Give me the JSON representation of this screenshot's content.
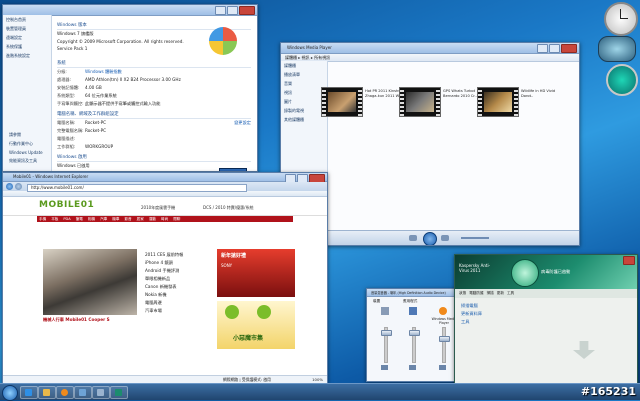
{
  "system_window": {
    "nav": [
      "控制台首頁",
      "裝置管理員",
      "遠端設定",
      "系統保護",
      "進階系統設定"
    ],
    "edition_head": "Windows 版本",
    "edition": "Windows 7 旗艦版",
    "copyright": "Copyright © 2009 Microsoft Corporation. All rights reserved.",
    "sp": "Service Pack 1",
    "system_head": "系統",
    "rows": [
      {
        "k": "分級:",
        "v": "Windows 體驗指數"
      },
      {
        "k": "處理器:",
        "v": "AMD Athlon(tm) II X2 B24 Processor 3.00 GHz"
      },
      {
        "k": "安裝記憶體:",
        "v": "4.00 GB"
      },
      {
        "k": "系統類型:",
        "v": "64 位元作業系統"
      },
      {
        "k": "手寫筆與觸控:",
        "v": "此顯示器不提供手寫筆或觸控式輸入功能"
      }
    ],
    "computer_head": "電腦名稱、網域及工作群組設定",
    "comp_rows": [
      {
        "k": "電腦名稱:",
        "v": "Rocket-PC"
      },
      {
        "k": "完整電腦名稱:",
        "v": "Rocket-PC"
      },
      {
        "k": "電腦描述:",
        "v": ""
      },
      {
        "k": "工作群組:",
        "v": "WORKGROUP"
      }
    ],
    "change_link": "變更設定",
    "activation_head": "Windows 啟用",
    "activation": "Windows 已啟用",
    "product_id": "產品識別碼:",
    "see_also": [
      "請參閱",
      "行動作業中心",
      "Windows Update",
      "效能資訊及工具"
    ]
  },
  "media_window": {
    "title": "Windows Media Player",
    "breadcrumb": "媒體櫃 ▸ 視訊 ▸ 所有視訊",
    "nav": [
      "媒體櫃",
      "播放清單",
      "音樂",
      "視訊",
      "圖片",
      "錄製的電視",
      "其他媒體櫃"
    ],
    "videos": [
      {
        "title": "Hot PR 2011 Kinshu Zhaga-kun 2011 Win..."
      },
      {
        "title": "GPS Whats Turbot Bernardo 2010 Cr..."
      },
      {
        "title": "Wildlife in HD Vivid Dorot.."
      }
    ]
  },
  "ie_window": {
    "title": "Mobile01 - Windows Internet Explorer",
    "url": "http://www.mobile01.com/",
    "logo": "MOBILE01",
    "banner1": "2010年度風雲手機",
    "banner2": "DCS / 2010 特賣/優惠/系統 ",
    "headline": "機械人行車 Mobile01 Cooper S",
    "menu": [
      "手機",
      "平板",
      "PDA",
      "筆電",
      "相機",
      "汽車",
      "機車",
      "影音",
      "居家",
      "運動",
      "時尚",
      "閒聊"
    ],
    "news": [
      "2011 CES 展前特報",
      "iPhone 4 鏡頭",
      "Android 手機評測",
      "單眼相機新品",
      "Canon 新機發表",
      "Nokia 新機",
      "電腦周邊",
      "汽車市場"
    ],
    "ad1_title": "新年搶好禮",
    "ad1_brand": "SONY",
    "ad2": "小惡魔市集",
    "status": "網際網路 | 受保護模式: 啟用",
    "zoom": "100%"
  },
  "mixer_window": {
    "title": "音量混音器 - 喇叭 (High Definition Audio Device)",
    "labels": [
      "裝置",
      "應用程式",
      "Windows Media Player"
    ]
  },
  "kaspersky": {
    "brand": "Kaspersky Anti-Virus 2011",
    "head": "病毒防護已啟動",
    "items": [
      "掃描電腦",
      "更新資料庫",
      "工具"
    ],
    "tabs": [
      "狀態",
      "電腦防護",
      "掃描",
      "更新",
      "工具"
    ]
  },
  "watermark": "#165231",
  "colors": {
    "accent": "#2a6fc9",
    "ie_red": "#b0121b",
    "kaspersky": "#1c8c6e"
  }
}
